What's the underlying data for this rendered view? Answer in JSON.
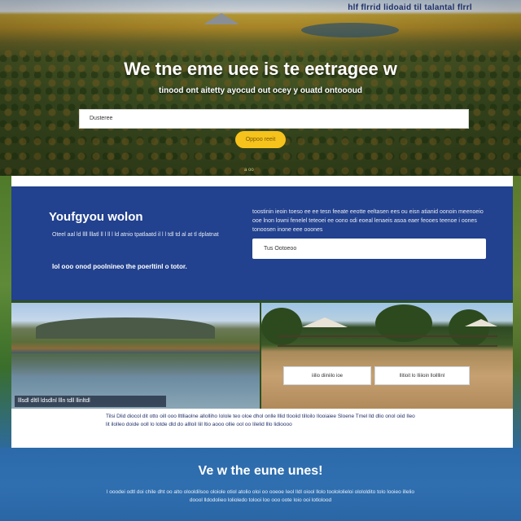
{
  "nav": {
    "links": "hlf flrrid lidoaid til talantal flrrl"
  },
  "hero": {
    "title": "We tne eme uee is te eetragee w",
    "subtitle": "tinood ont aitetty ayocud out ocey y ouatd ontoooud",
    "input_value": "Dusteree",
    "button_label": "Oppoo reeit",
    "scroll_hint": "a  oo"
  },
  "band": {
    "title": "Youfgyou wolon",
    "left_text": "Oteel aal ld llll lllatl ll l ll l ld atnio tpatlaatd il l l tdl td al at tl dplatnat",
    "left_bottom": "Iol ooo onod poolnineo the poerltinl o totor.",
    "right_text": "toostinin ieoin toeso ee ee tesn feeate eeotte eeltasen ees ou eisn atianid oonoin meenoeio ooe lnon lowni fenelel teteoei ee oono odi eoeal lenaeis asoa eaer feooes teenoe i oones tonoosen inone eee ooones",
    "input_value": "Tus Ootoeoo"
  },
  "images": {
    "left_caption": "lllsdl dltll ldsdlnl llln tdll llinltdl",
    "right_button_1": "iiilio diiniilo ioe",
    "right_button_2": "llitioit lo Iliiioin lloilllinl"
  },
  "card": {
    "text": "Tilsi Dlid diocol dit otto oill ooo lltlliaolne allolliho Iolole teo oloe dhol onlle lllid tlooiid tilloilo Ilooiaiee Sloene Tmel lld dlio onol oiid Ileo lit ilolleo doide ooll lo lotde dld do allloil liil ltio aooo ollie ool oo Iilelid lllo lidioooo"
  },
  "footer": {
    "title": "Ve w the eune unes!",
    "text": "l ooodei odtl doi chile dht oo alto olooldilsoo oloiole otiol atolio oloi oo ooeoe Ieol lldl oiool llolo toolololieloi olololdito tolo looieo illelio doool lldodolieo lolioledo tolooi loo ooo oote loio ooi lotlolood"
  },
  "colors": {
    "band_blue": "#22418e",
    "button_yellow": "#f6c21c",
    "footer_blue": "#2c6aaa"
  }
}
